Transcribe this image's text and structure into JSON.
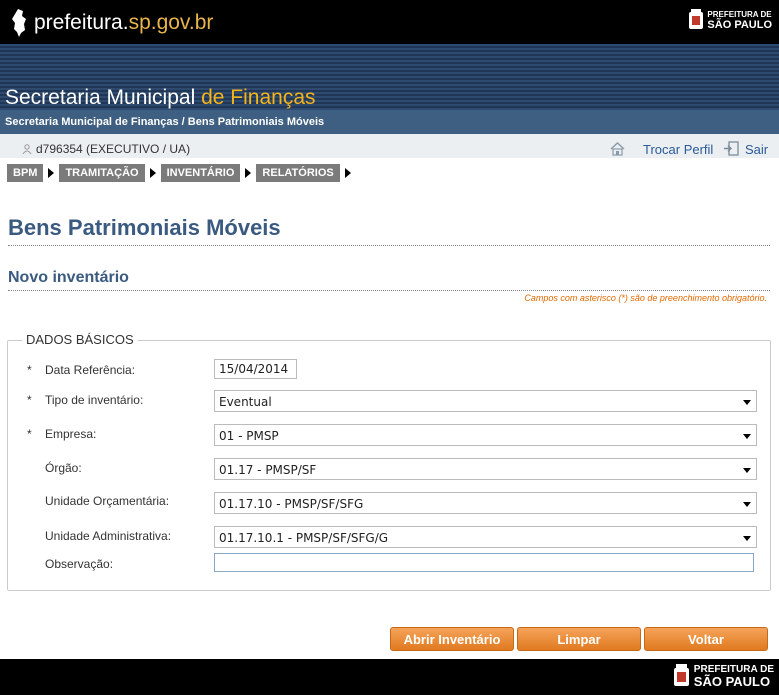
{
  "header": {
    "portal_text": "prefeitura.",
    "portal_domain": "sp.gov.br",
    "brand_line1": "PREFEITURA DE",
    "brand_line2": "SÃO PAULO",
    "colors": {
      "accent": "#f5b41a",
      "banner": "#2e4a6e",
      "crumb_bg": "#3e5f82"
    }
  },
  "banner": {
    "title_main": "Secretaria Municipal ",
    "title_highlight": "de Finanças"
  },
  "breadcrumb": "Secretaria Municipal de Finanças / Bens Patrimoniais Móveis",
  "userbar": {
    "user": "d796354 (EXECUTIVO / UA)",
    "trocar_perfil": "Trocar Perfil",
    "sair": "Sair"
  },
  "menu": {
    "items": [
      "BPM",
      "TRAMITAÇÃO",
      "INVENTÁRIO",
      "RELATÓRIOS"
    ]
  },
  "page": {
    "title": "Bens Patrimoniais Móveis",
    "subtitle": "Novo inventário",
    "required_note": "Campos com asterisco (*) são de preenchimento obrigatório."
  },
  "form": {
    "legend": "DADOS BÁSICOS",
    "data_referencia": {
      "label": "Data Referência:",
      "value": "15/04/2014",
      "required": "*"
    },
    "tipo_inventario": {
      "label": "Tipo de inventário:",
      "value": "Eventual",
      "required": "*"
    },
    "empresa": {
      "label": "Empresa:",
      "value": "01 - PMSP",
      "required": "*"
    },
    "orgao": {
      "label": "Órgão:",
      "value": "01.17 - PMSP/SF"
    },
    "unidade_orcamentaria": {
      "label": "Unidade Orçamentária:",
      "value": "01.17.10 - PMSP/SF/SFG"
    },
    "unidade_administrativa": {
      "label": "Unidade Administrativa:",
      "value": "01.17.10.1 - PMSP/SF/SFG/G"
    },
    "observacao": {
      "label": "Observação:",
      "value": ""
    }
  },
  "buttons": {
    "abrir": "Abrir Inventário",
    "limpar": "Limpar",
    "voltar": "Voltar"
  },
  "footer": {
    "brand_line1": "PREFEITURA DE",
    "brand_line2": "SÃO PAULO"
  }
}
